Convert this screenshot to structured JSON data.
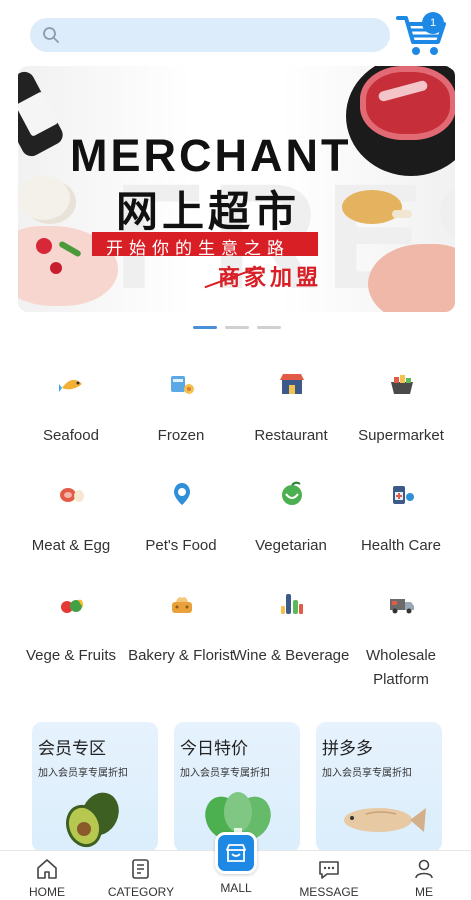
{
  "search": {
    "placeholder": "",
    "value": ""
  },
  "cart": {
    "badge_count": "1",
    "accent": "#1e88e5"
  },
  "banner": {
    "headline": "MERCHANT",
    "cn_title": "网上超市",
    "ribbon_text": "开始你的生意之路",
    "join_text": "商家加盟",
    "watermark": "FRESH",
    "active_slide": 1,
    "slide_count": 3
  },
  "categories": [
    {
      "label": "Seafood",
      "icon": "seafood-icon"
    },
    {
      "label": "Frozen",
      "icon": "frozen-icon"
    },
    {
      "label": "Restaurant",
      "icon": "restaurant-icon"
    },
    {
      "label": "Supermarket",
      "icon": "supermarket-basket-icon"
    },
    {
      "label": "Meat & Egg",
      "icon": "meat-egg-icon"
    },
    {
      "label": "Pet's Food",
      "icon": "pet-food-icon"
    },
    {
      "label": "Vegetarian",
      "icon": "vegetarian-icon"
    },
    {
      "label": "Health Care",
      "icon": "health-care-icon"
    },
    {
      "label": "Vege & Fruits",
      "icon": "vege-fruits-icon"
    },
    {
      "label": "Bakery & Florist",
      "icon": "bakery-florist-icon"
    },
    {
      "label": "Wine & Beverage",
      "icon": "wine-beverage-icon"
    },
    {
      "label": "Wholesale Platform",
      "icon": "wholesale-truck-icon"
    }
  ],
  "promos": [
    {
      "title": "会员专区",
      "subtitle": "加入会员享专属折扣",
      "image": "avocado"
    },
    {
      "title": "今日特价",
      "subtitle": "加入会员享专属折扣",
      "image": "greens"
    },
    {
      "title": "拼多多",
      "subtitle": "加入会员享专属折扣",
      "image": "fish"
    }
  ],
  "nav": {
    "items": [
      {
        "label": "HOME",
        "icon": "home-icon"
      },
      {
        "label": "CATEGORY",
        "icon": "category-icon"
      },
      {
        "label": "MALL",
        "icon": "mall-store-icon"
      },
      {
        "label": "MESSAGE",
        "icon": "message-icon"
      },
      {
        "label": "ME",
        "icon": "person-icon"
      }
    ],
    "active_index": 2
  },
  "colors": {
    "accent": "#1e88e5",
    "search_bg": "#dcecfb",
    "banner_red": "#d81f26"
  }
}
